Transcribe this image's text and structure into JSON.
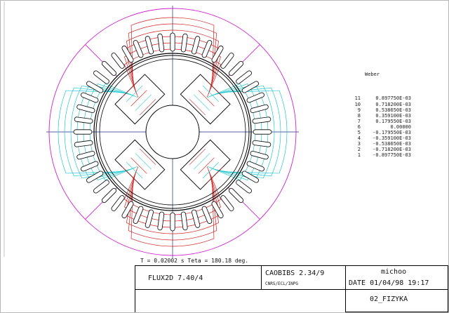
{
  "legend": {
    "unit": "Weber",
    "levels": [
      {
        "index": "11",
        "value": "0.897750E-03"
      },
      {
        "index": "10",
        "value": "0.718200E-03"
      },
      {
        "index": "9",
        "value": "0.538650E-03"
      },
      {
        "index": "8",
        "value": "0.359100E-03"
      },
      {
        "index": "7",
        "value": "0.179550E-03"
      },
      {
        "index": "6",
        "value": "0.00000"
      },
      {
        "index": "5",
        "value": "-0.179550E-03"
      },
      {
        "index": "4",
        "value": "-0.359100E-03"
      },
      {
        "index": "3",
        "value": "-0.538650E-03"
      },
      {
        "index": "2",
        "value": "-0.718200E-03"
      },
      {
        "index": "1",
        "value": "-0.897750E-03"
      }
    ]
  },
  "status_line": "T = 0.02002 s Teta = 180.18 deg.",
  "title_block": {
    "software": "FLUX2D 7.40/4",
    "mesher": "CAOBIBS 2.34/9",
    "org": "CNRS/ECL/INPG",
    "user": "michoo",
    "date": "DATE 01/04/98 19:17",
    "project": "02_FIZYKA"
  },
  "colors": {
    "positive_flux": "#d42020",
    "negative_flux": "#20c8d0",
    "boundary": "#d020d0",
    "structure": "#000000",
    "axis": "#1a2a80"
  }
}
